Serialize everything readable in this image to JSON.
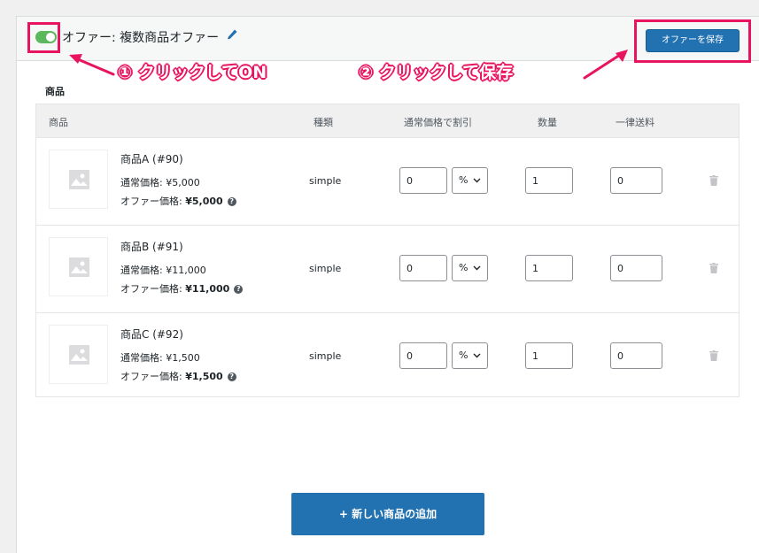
{
  "header": {
    "offer_title": "オファー: 複数商品オファー",
    "save_label": "オファーを保存"
  },
  "annotations": {
    "step1": "① クリックしてON",
    "step2": "② クリックして保存"
  },
  "section_label": "商品",
  "table": {
    "headers": [
      "商品",
      "種類",
      "通常価格で割引",
      "数量",
      "一律送料"
    ],
    "rows": [
      {
        "name": "商品A (#90)",
        "regular": "通常価格: ¥5,000",
        "offer_prefix": "オファー価格: ",
        "offer_value": "¥5,000",
        "type": "simple",
        "discount": "0",
        "unit": "%",
        "qty": "1",
        "shipping": "0"
      },
      {
        "name": "商品B (#91)",
        "regular": "通常価格: ¥11,000",
        "offer_prefix": "オファー価格: ",
        "offer_value": "¥11,000",
        "type": "simple",
        "discount": "0",
        "unit": "%",
        "qty": "1",
        "shipping": "0"
      },
      {
        "name": "商品C (#92)",
        "regular": "通常価格: ¥1,500",
        "offer_prefix": "オファー価格: ",
        "offer_value": "¥1,500",
        "type": "simple",
        "discount": "0",
        "unit": "%",
        "qty": "1",
        "shipping": "0"
      }
    ]
  },
  "add_button_label": "+ 新しい商品の追加",
  "colors": {
    "accent": "#2271b1",
    "highlight": "#e8145f",
    "toggle_on": "#5cb85c"
  },
  "icons": [
    "pencil-icon",
    "image-icon",
    "help-icon",
    "chevron-down-icon",
    "trash-icon"
  ]
}
